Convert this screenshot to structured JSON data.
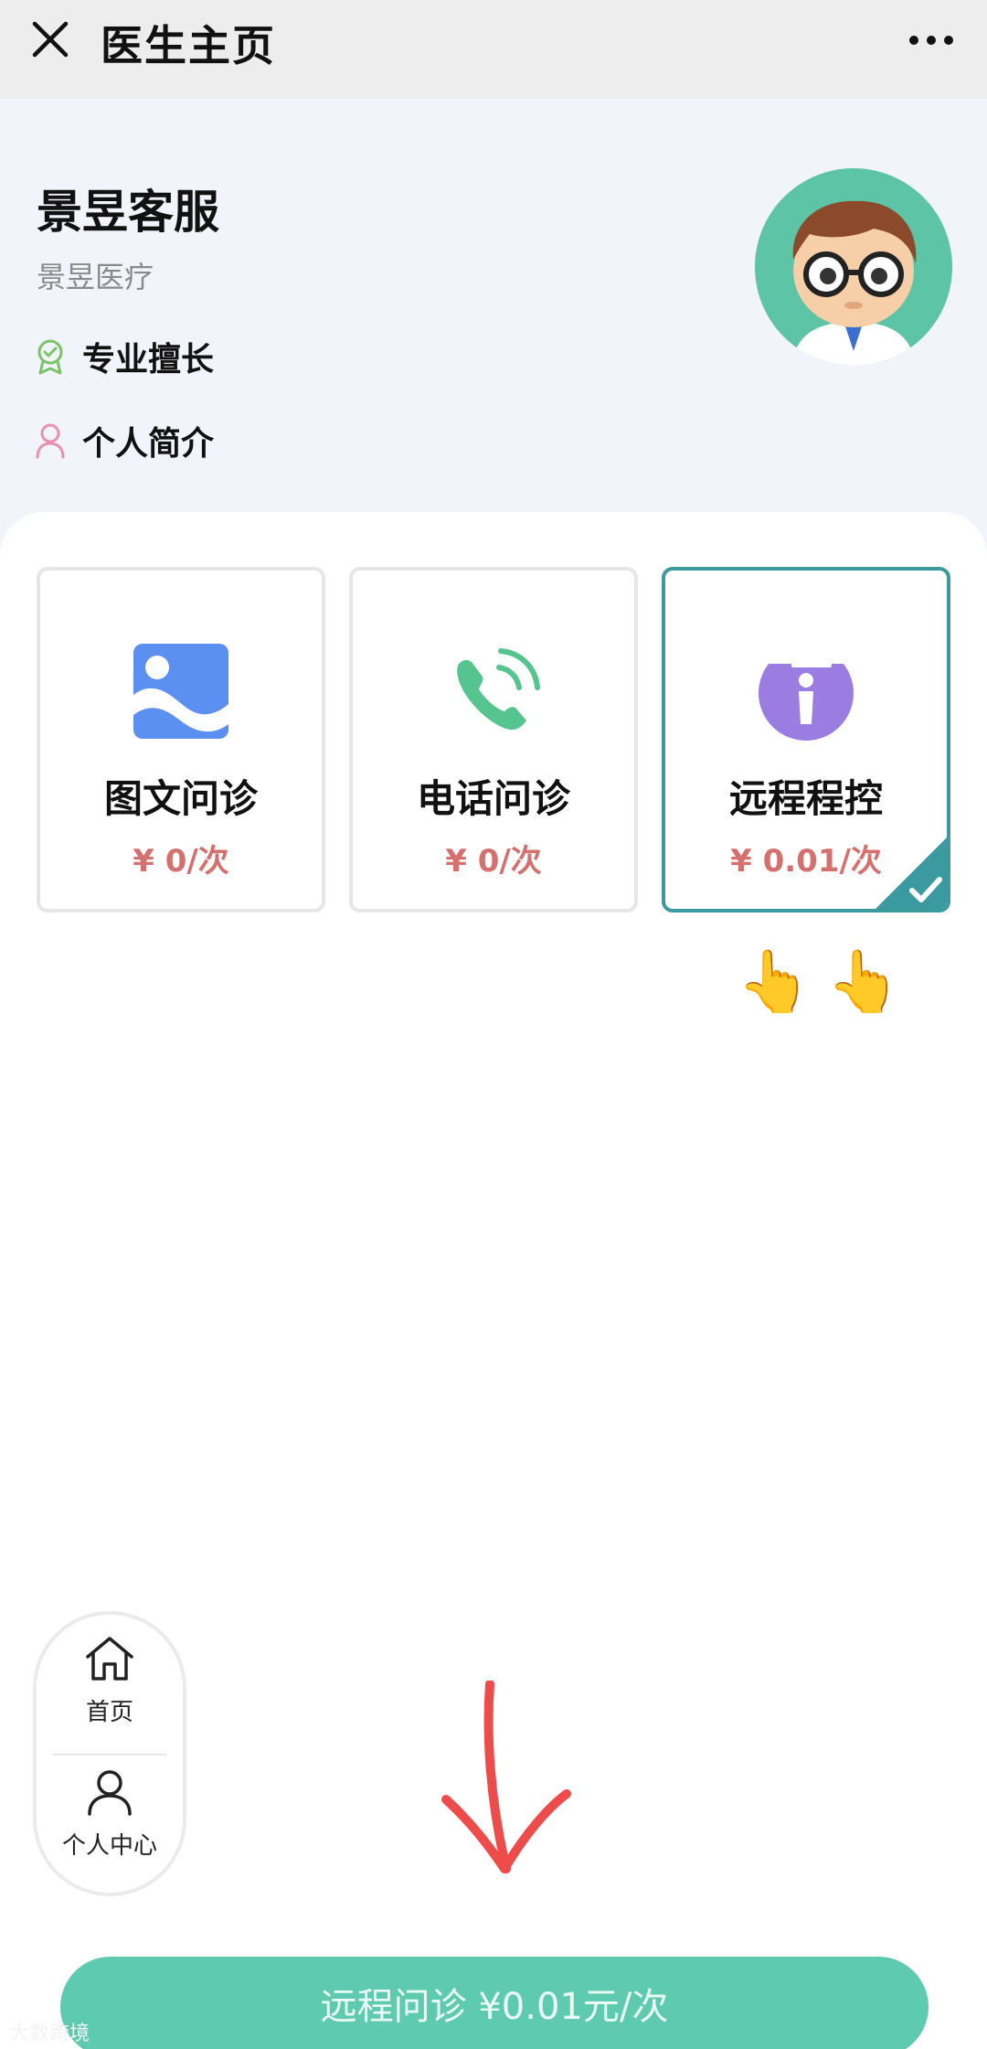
{
  "header": {
    "title": "医生主页",
    "close_icon": "close-icon",
    "more_icon": "more-icon"
  },
  "doctor": {
    "name": "景昱客服",
    "organization": "景昱医疗",
    "specialty_label": "专业擅长",
    "intro_label": "个人简介"
  },
  "services": [
    {
      "name": "图文问诊",
      "price": "¥ 0/次",
      "icon": "image-icon",
      "selected": false
    },
    {
      "name": "电话问诊",
      "price": "¥ 0/次",
      "icon": "phone-icon",
      "selected": false
    },
    {
      "name": "远程程控",
      "price": "¥ 0.01/次",
      "icon": "remote-icon",
      "selected": true
    }
  ],
  "pointing_hands": "👆👆",
  "float_nav": {
    "home_label": "首页",
    "profile_label": "个人中心"
  },
  "bottom_button": {
    "label": "远程问诊 ¥0.01元/次"
  },
  "watermark": "大数跨境",
  "colors": {
    "accent": "#5ecab0",
    "selected_border": "#3b9aa0",
    "price": "#d4716f",
    "header_bg": "#ededed",
    "profile_bg": "#f1f4fb"
  }
}
